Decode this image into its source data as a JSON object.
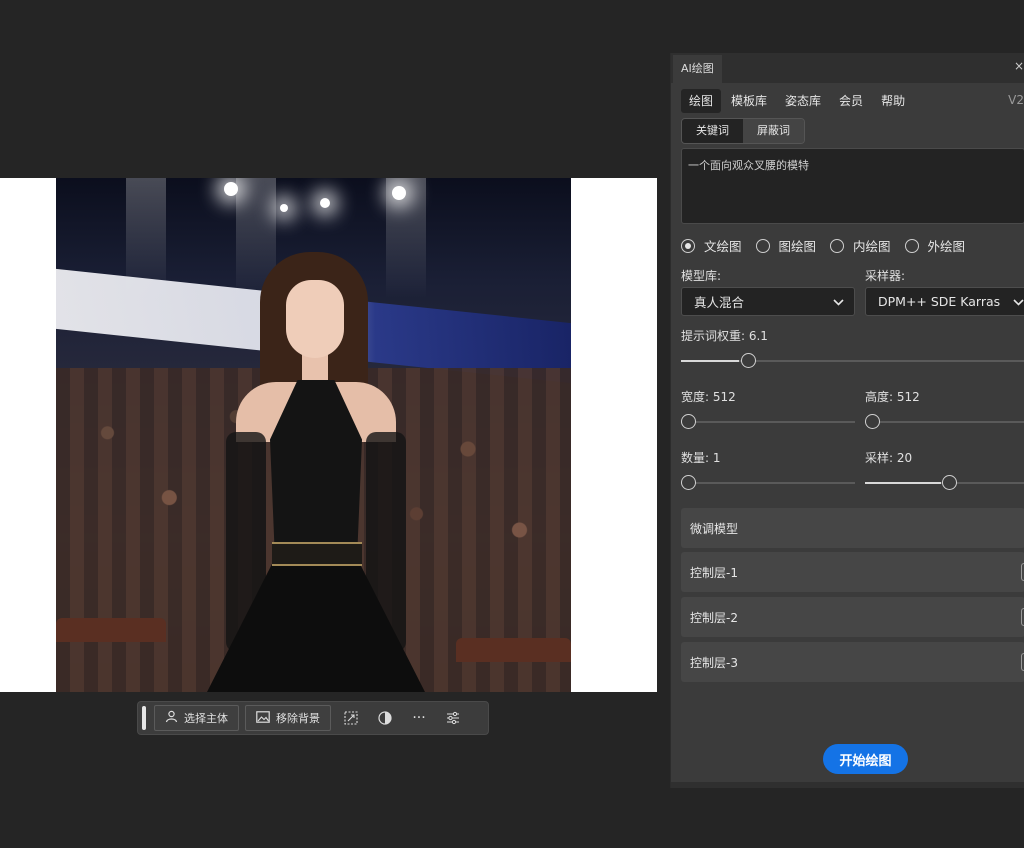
{
  "toolbar": {
    "select_subject": "选择主体",
    "remove_background": "移除背景",
    "more": "···"
  },
  "panel": {
    "tab_title": "AI绘图",
    "close": "×",
    "version": "V2",
    "nav": [
      "绘图",
      "模板库",
      "姿态库",
      "会员",
      "帮助"
    ],
    "subtabs": [
      "关键词",
      "屏蔽词"
    ],
    "prompt_text": "一个面向观众叉腰的模特",
    "modes": [
      "文绘图",
      "图绘图",
      "内绘图",
      "外绘图"
    ],
    "selected_mode": "文绘图",
    "model_label": "模型库:",
    "model_value": "真人混合",
    "sampler_label": "采样器:",
    "sampler_value": "DPM++ SDE Karras",
    "prompt_weight_label": "提示词权重: 6.1",
    "prompt_weight": 6.1,
    "width_label": "宽度: 512",
    "height_label": "高度: 512",
    "count_label": "数量: 1",
    "steps_label": "采样: 20",
    "finetune_label": "微调模型",
    "control1": "控制层-1",
    "control2": "控制层-2",
    "control3": "控制层-3",
    "start_button": "开始绘图",
    "accent_color": "#1473e6"
  }
}
